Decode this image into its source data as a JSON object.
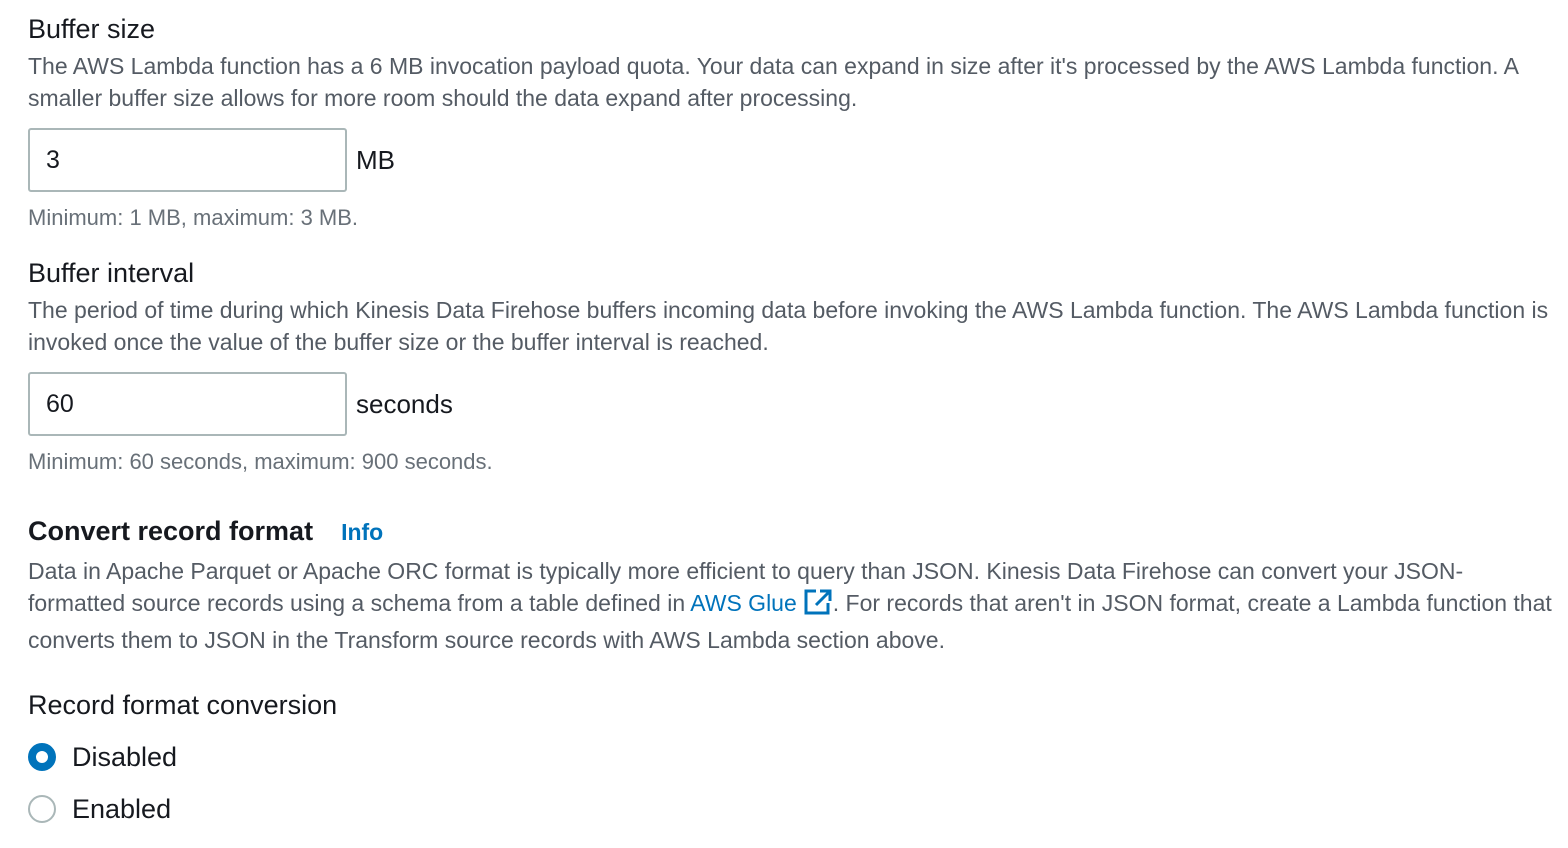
{
  "buffer_size": {
    "label": "Buffer size",
    "description": "The AWS Lambda function has a 6 MB invocation payload quota. Your data can expand in size after it's processed by the AWS Lambda function. A smaller buffer size allows for more room should the data expand after processing.",
    "value": "3",
    "unit": "MB",
    "constraint": "Minimum: 1 MB, maximum: 3 MB."
  },
  "buffer_interval": {
    "label": "Buffer interval",
    "description": "The period of time during which Kinesis Data Firehose buffers incoming data before invoking the AWS Lambda function. The AWS Lambda function is invoked once the value of the buffer size or the buffer interval is reached.",
    "value": "60",
    "unit": "seconds",
    "constraint": "Minimum: 60 seconds, maximum: 900 seconds."
  },
  "convert_record_format": {
    "heading": "Convert record format",
    "info_link": "Info",
    "description_before": "Data in Apache Parquet or Apache ORC format is typically more efficient to query than JSON. Kinesis Data Firehose can convert your JSON-formatted source records using a schema from a table defined in ",
    "glue_link": "AWS Glue",
    "description_after": ". For records that aren't in JSON format, create a Lambda function that converts them to JSON in the Transform source records with AWS Lambda section above.",
    "external_icon": "external-link-icon",
    "accent_color": "#0073bb"
  },
  "record_format_conversion": {
    "label": "Record format conversion",
    "options": [
      {
        "label": "Disabled",
        "selected": true
      },
      {
        "label": "Enabled",
        "selected": false
      }
    ]
  }
}
